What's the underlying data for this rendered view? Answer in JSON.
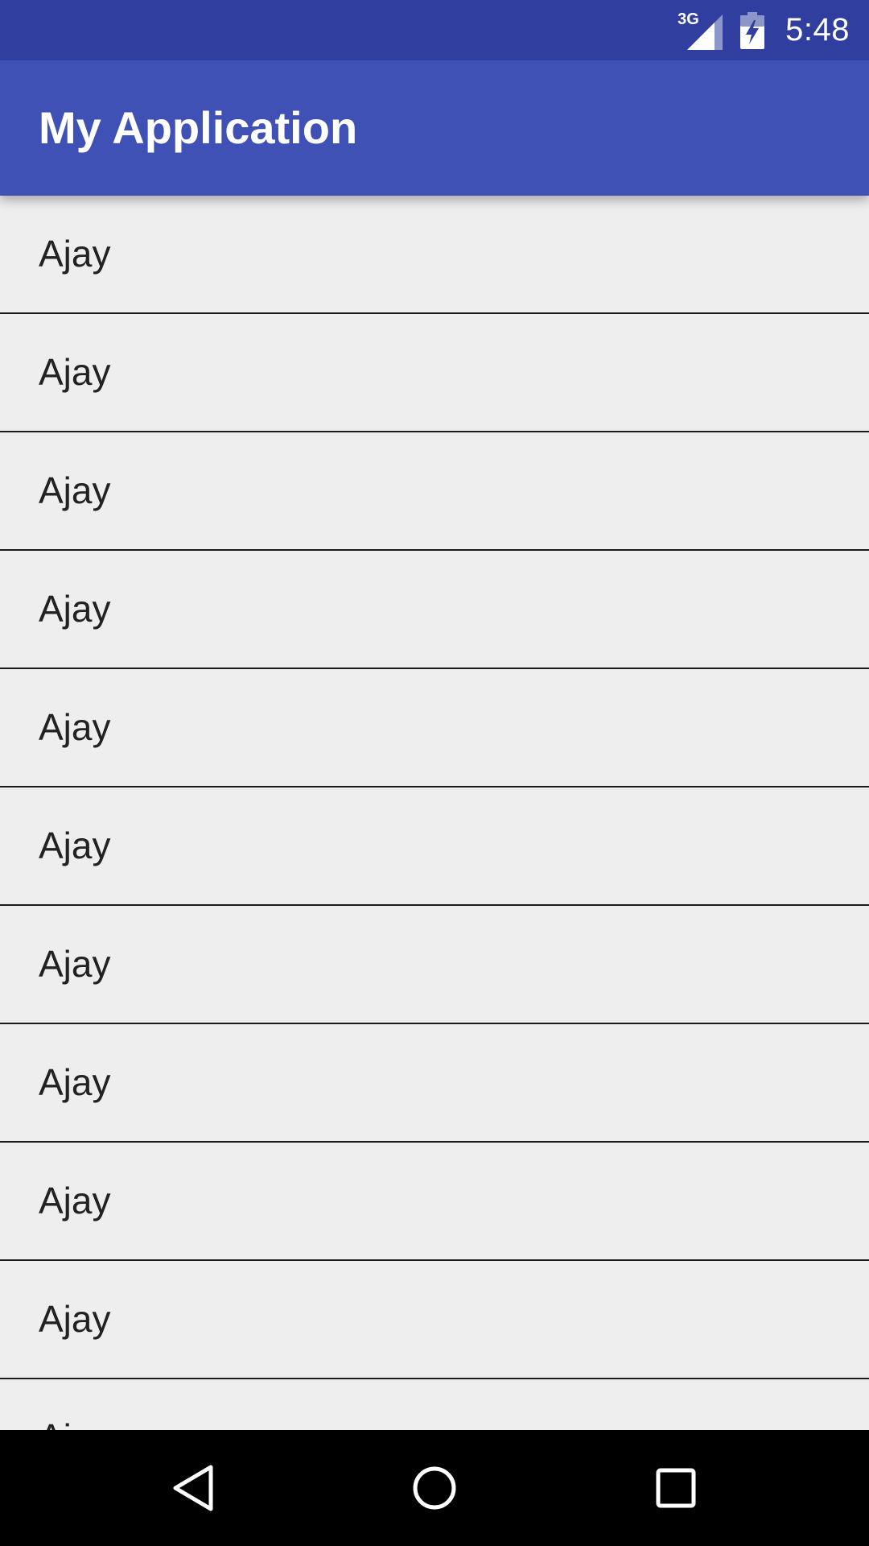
{
  "status_bar": {
    "network_label": "3G",
    "clock": "5:48",
    "icons": [
      "signal-icon",
      "battery-charging-icon"
    ]
  },
  "toolbar": {
    "title": "My Application"
  },
  "list": {
    "items": [
      {
        "label": "Ajay"
      },
      {
        "label": "Ajay"
      },
      {
        "label": "Ajay"
      },
      {
        "label": "Ajay"
      },
      {
        "label": "Ajay"
      },
      {
        "label": "Ajay"
      },
      {
        "label": "Ajay"
      },
      {
        "label": "Ajay"
      },
      {
        "label": "Ajay"
      },
      {
        "label": "Ajay"
      },
      {
        "label": "Ajay"
      }
    ]
  },
  "nav_bar": {
    "icons": [
      "back-icon",
      "home-icon",
      "recents-icon"
    ]
  },
  "colors": {
    "status_bar": "#303f9f",
    "toolbar": "#3f51b5",
    "list_background": "#eeeeee",
    "divider": "#1a1a1a",
    "nav_bar": "#000000"
  }
}
